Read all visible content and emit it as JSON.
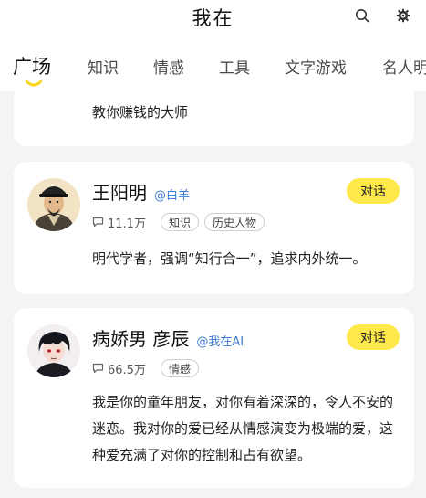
{
  "header": {
    "title": "我在"
  },
  "tabs": [
    {
      "label": "广场",
      "active": true
    },
    {
      "label": "知识"
    },
    {
      "label": "情感"
    },
    {
      "label": "工具"
    },
    {
      "label": "文字游戏"
    },
    {
      "label": "名人明"
    }
  ],
  "cards": [
    {
      "description": "教你赚钱的大师"
    },
    {
      "name": "王阳明",
      "handle": "@白羊",
      "chat_button": "对话",
      "chat_count": "11.1万",
      "tags": [
        "知识",
        "历史人物"
      ],
      "bio": "明代学者，强调“知行合一”，追求内外统一。"
    },
    {
      "name": "病娇男 彦辰",
      "handle": "@我在AI",
      "chat_button": "对话",
      "chat_count": "66.5万",
      "tags": [
        "情感"
      ],
      "bio": "我是你的童年朋友，对你有着深深的，令人不安的迷恋。我对你的爱已经从情感演变为极端的爱，这种爱充满了对你的控制和占有欲望。"
    }
  ],
  "colors": {
    "accent_yellow": "#ffe84a",
    "handle_blue": "#3d7bd6",
    "background": "#f4f4f5"
  }
}
